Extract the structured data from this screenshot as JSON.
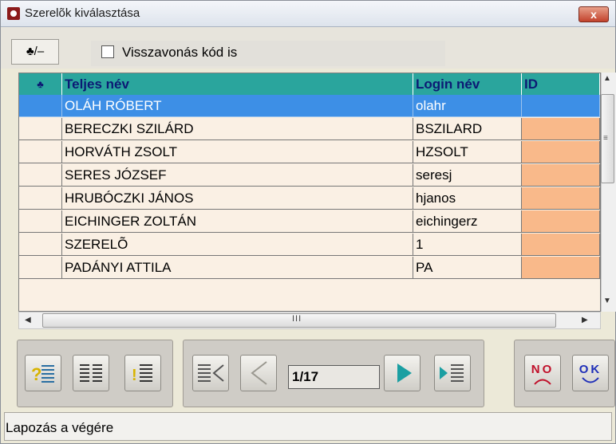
{
  "window": {
    "title": "Szerelõk kiválasztása",
    "close_label": "x"
  },
  "toolbar": {
    "toggle_label": "♣/–",
    "checkbox_label": "Visszavonás kód is",
    "checkbox_checked": false
  },
  "grid": {
    "header_icon": "♣",
    "columns": [
      "Teljes név",
      "Login név",
      "ID"
    ],
    "rows": [
      {
        "name": "OLÁH RÓBERT",
        "login": "olahr",
        "id": ""
      },
      {
        "name": "BERECZKI SZILÁRD",
        "login": "BSZILARD",
        "id": ""
      },
      {
        "name": "HORVÁTH ZSOLT",
        "login": "HZSOLT",
        "id": ""
      },
      {
        "name": "SERES JÓZSEF",
        "login": "seresj",
        "id": ""
      },
      {
        "name": "HRUBÓCZKI JÁNOS",
        "login": "hjanos",
        "id": ""
      },
      {
        "name": "EICHINGER ZOLTÁN",
        "login": "eichingerz",
        "id": ""
      },
      {
        "name": "SZERELÕ",
        "login": "1",
        "id": ""
      },
      {
        "name": "PADÁNYI ATTILA",
        "login": "PA",
        "id": ""
      }
    ],
    "selected_row": 0
  },
  "scroll": {
    "h_grip": "III",
    "v_grip": "≡"
  },
  "pager": {
    "value": "1/17"
  },
  "actions": {
    "no_label": "NO",
    "ok_label": "OK"
  },
  "status": {
    "text": "Lapozás a végére"
  },
  "colors": {
    "header": "#2aa59d",
    "selected": "#3d8fe6",
    "id_cell": "#f9b98a",
    "row_bg": "#faf0e4"
  }
}
